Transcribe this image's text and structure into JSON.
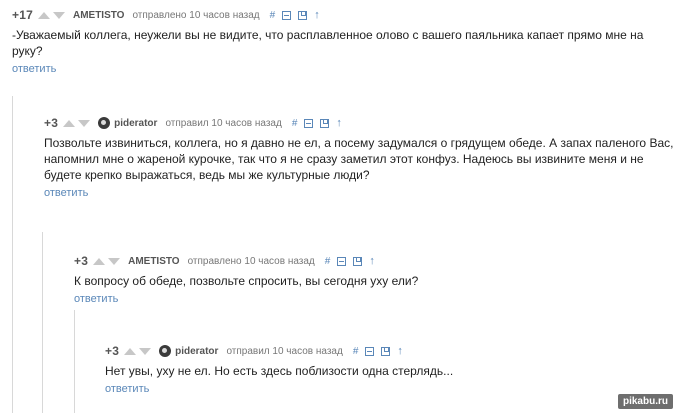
{
  "comments": [
    {
      "score": "+17",
      "author": "AMETISTO",
      "posted": "отправлено 10 часов назад",
      "link": "#",
      "text": "-Уважаемый коллега, неужели вы не видите, что расплавленное олово с вашего паяльника капает прямо мне на руку?",
      "reply": "ответить"
    },
    {
      "score": "+3",
      "author": "piderator",
      "posted": "отправил 10 часов назад",
      "link": "#",
      "text": "Позвольте извиниться, коллега, но я давно не ел, а посему задумался о грядущем обеде. А запах паленого Вас, напомнил мне о жареной курочке, так что я не сразу заметил этот конфуз. Надеюсь вы извините меня и не будете крепко выражаться, ведь мы же культурные люди?",
      "reply": "ответить"
    },
    {
      "score": "+3",
      "author": "AMETISTO",
      "posted": "отправлено 10 часов назад",
      "link": "#",
      "text": "К вопросу об обеде, позвольте спросить, вы сегодня уху ели?",
      "reply": "ответить"
    },
    {
      "score": "+3",
      "author": "piderator",
      "posted": "отправил 10 часов назад",
      "link": "#",
      "text": "Нет увы, уху не ел. Но есть здесь поблизости одна стерлядь...",
      "reply": "ответить"
    }
  ],
  "icons": {
    "upvote": "triangle-up-icon",
    "downvote": "triangle-down-icon",
    "collapse": "minus-box-icon",
    "save": "save-icon",
    "parent": "arrow-up-icon"
  },
  "colors": {
    "link": "#5a87b8",
    "text": "#222222",
    "meta": "#777777",
    "vote_arrow": "#c7c7c7"
  },
  "watermark": "pikabu.ru"
}
